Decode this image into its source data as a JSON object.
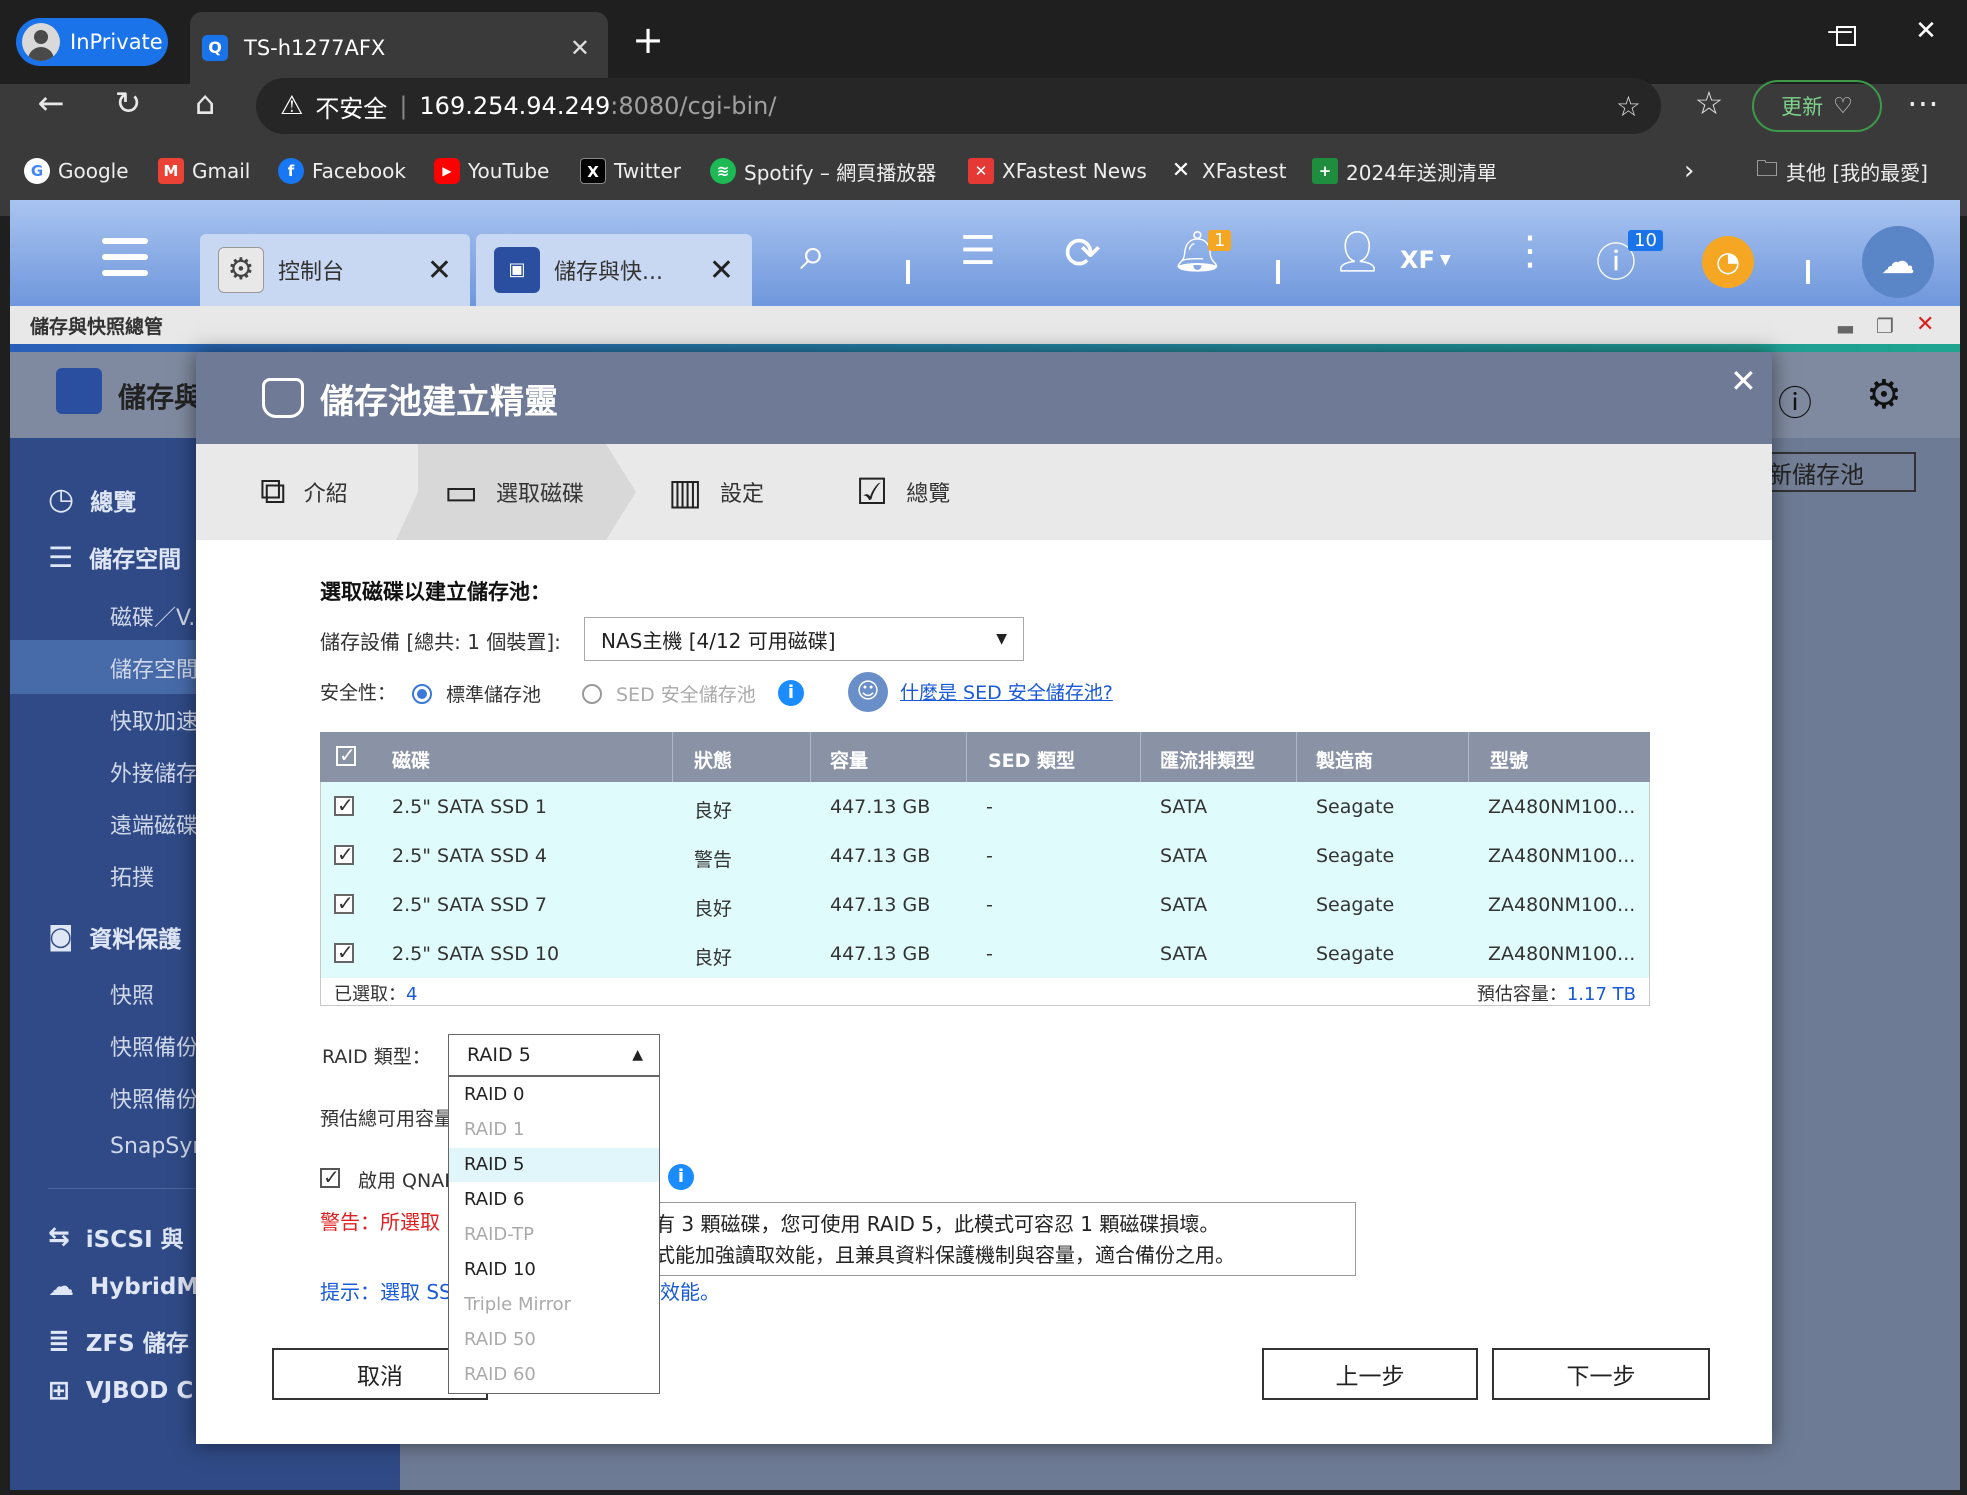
{
  "browser": {
    "inprivate_label": "InPrivate",
    "tab_title": "TS-h1277AFX",
    "address": {
      "security": "不安全",
      "host": "169.254.94.249",
      "path": ":8080/cgi-bin/"
    },
    "update_label": "更新",
    "bookmarks": [
      {
        "label": "Google",
        "color": "#4285f4",
        "glyph": "G"
      },
      {
        "label": "Gmail",
        "color": "#ea4335",
        "glyph": "M"
      },
      {
        "label": "Facebook",
        "color": "#1877f2",
        "glyph": "f"
      },
      {
        "label": "YouTube",
        "color": "#ff0000",
        "glyph": "▶"
      },
      {
        "label": "Twitter",
        "color": "#000000",
        "glyph": "X"
      },
      {
        "label": "Spotify – 網頁播放器",
        "color": "#1db954",
        "glyph": "≋"
      },
      {
        "label": "XFastest News",
        "color": "#e53935",
        "glyph": "✕"
      },
      {
        "label": "XFastest",
        "color": "#222222",
        "glyph": "✕"
      },
      {
        "label": "2024年送測清單",
        "color": "#1e8e3e",
        "glyph": "+"
      }
    ],
    "other_bookmarks": "其他 [我的最愛]"
  },
  "qnap": {
    "tabs": [
      {
        "label": "控制台"
      },
      {
        "label": "儲存與快..."
      }
    ],
    "user": "XF",
    "notify_badge": "1",
    "info_badge": "10",
    "window_title": "儲存與快照總管",
    "app_title": "儲存與",
    "new_pool_button": "新儲存池",
    "sidebar": {
      "overview": "總覽",
      "storage": "儲存空間",
      "disks": "磁碟／V...",
      "pools": "儲存空間",
      "cache": "快取加速",
      "external": "外接儲存",
      "remote": "遠端磁碟",
      "topology": "拓撲",
      "protection": "資料保護",
      "snapshot": "快照",
      "snap_backup1": "快照備份",
      "snap_backup2": "快照備份",
      "snapsync": "SnapSync",
      "iscsi": "iSCSI 與",
      "hybridmount": "HybridMo",
      "zfs": "ZFS 儲存",
      "vjbod": "VJBOD C"
    }
  },
  "wizard": {
    "title": "儲存池建立精靈",
    "steps": [
      {
        "label": "介紹"
      },
      {
        "label": "選取磁碟"
      },
      {
        "label": "設定"
      },
      {
        "label": "總覽"
      }
    ],
    "section_title": "選取磁碟以建立儲存池：",
    "device_label": "儲存設備 [總共: 1 個裝置]:",
    "device_value": "NAS主機 [4/12 可用磁碟]",
    "security_label": "安全性：",
    "security_standard": "標準儲存池",
    "security_sed": "SED 安全儲存池",
    "sed_link": "什麼是 SED 安全儲存池?",
    "columns": [
      "磁碟",
      "狀態",
      "容量",
      "SED 類型",
      "匯流排類型",
      "製造商",
      "型號"
    ],
    "disks": [
      {
        "name": "2.5\" SATA SSD 1",
        "status": "良好",
        "capacity": "447.13 GB",
        "sed": "-",
        "bus": "SATA",
        "vendor": "Seagate",
        "model": "ZA480NM100..."
      },
      {
        "name": "2.5\" SATA SSD 4",
        "status": "警告",
        "capacity": "447.13 GB",
        "sed": "-",
        "bus": "SATA",
        "vendor": "Seagate",
        "model": "ZA480NM100..."
      },
      {
        "name": "2.5\" SATA SSD 7",
        "status": "良好",
        "capacity": "447.13 GB",
        "sed": "-",
        "bus": "SATA",
        "vendor": "Seagate",
        "model": "ZA480NM100..."
      },
      {
        "name": "2.5\" SATA SSD 10",
        "status": "良好",
        "capacity": "447.13 GB",
        "sed": "-",
        "bus": "SATA",
        "vendor": "Seagate",
        "model": "ZA480NM100..."
      }
    ],
    "selected_label": "已選取：",
    "selected_count": "4",
    "est_capacity_label": "預估容量：",
    "est_capacity": "1.17 TB",
    "raid_label": "RAID 類型：",
    "raid_value": "RAID 5",
    "raid_options": [
      {
        "label": "RAID 0",
        "disabled": false
      },
      {
        "label": "RAID 1",
        "disabled": true
      },
      {
        "label": "RAID 5",
        "disabled": false
      },
      {
        "label": "RAID 6",
        "disabled": false
      },
      {
        "label": "RAID-TP",
        "disabled": true
      },
      {
        "label": "RAID 10",
        "disabled": false
      },
      {
        "label": "Triple Mirror",
        "disabled": true
      },
      {
        "label": "RAID 50",
        "disabled": true
      },
      {
        "label": "RAID 60",
        "disabled": true
      }
    ],
    "total_cap_label": "預估總可用容量",
    "qnap_option": "啟用 QNAP",
    "warning": "警告：所選取",
    "hint_start": "提示：選取 SS",
    "hint_end": "效能。",
    "tooltip_line1": "若您有 3 顆磁碟，您可使用 RAID 5，此模式可容忍 1 顆磁碟損壞。",
    "tooltip_line2": "此模式能加強讀取效能，且兼具資料保護機制與容量，適合備份之用。",
    "cancel": "取消",
    "back": "上一步",
    "next": "下一步"
  }
}
